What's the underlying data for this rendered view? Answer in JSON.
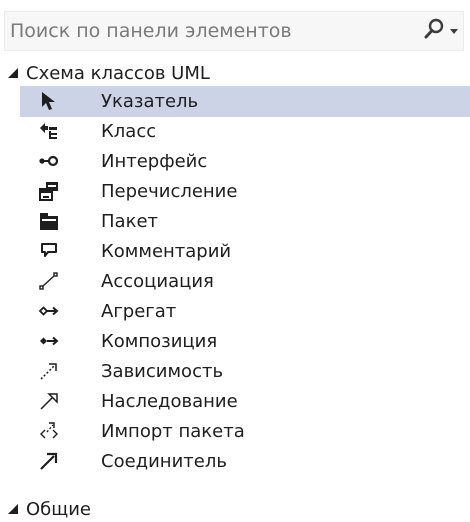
{
  "search": {
    "placeholder": "Поиск по панели элементов"
  },
  "groups": [
    {
      "label": "Схема классов UML",
      "items": [
        {
          "label": "Указатель",
          "icon": "pointer-icon",
          "selected": true
        },
        {
          "label": "Класс",
          "icon": "class-icon"
        },
        {
          "label": "Интерфейс",
          "icon": "interface-icon"
        },
        {
          "label": "Перечисление",
          "icon": "enumeration-icon"
        },
        {
          "label": "Пакет",
          "icon": "package-icon"
        },
        {
          "label": "Комментарий",
          "icon": "comment-icon"
        },
        {
          "label": "Ассоциация",
          "icon": "association-icon"
        },
        {
          "label": "Агрегат",
          "icon": "aggregation-icon"
        },
        {
          "label": "Композиция",
          "icon": "composition-icon"
        },
        {
          "label": "Зависимость",
          "icon": "dependency-icon"
        },
        {
          "label": "Наследование",
          "icon": "inheritance-icon"
        },
        {
          "label": "Импорт пакета",
          "icon": "package-import-icon"
        },
        {
          "label": "Соединитель",
          "icon": "connector-icon"
        }
      ]
    },
    {
      "label": "Общие",
      "items": []
    }
  ],
  "colors": {
    "selection": "#cdd3e6",
    "text": "#1e1e1e",
    "placeholder": "#7a7a7a"
  }
}
